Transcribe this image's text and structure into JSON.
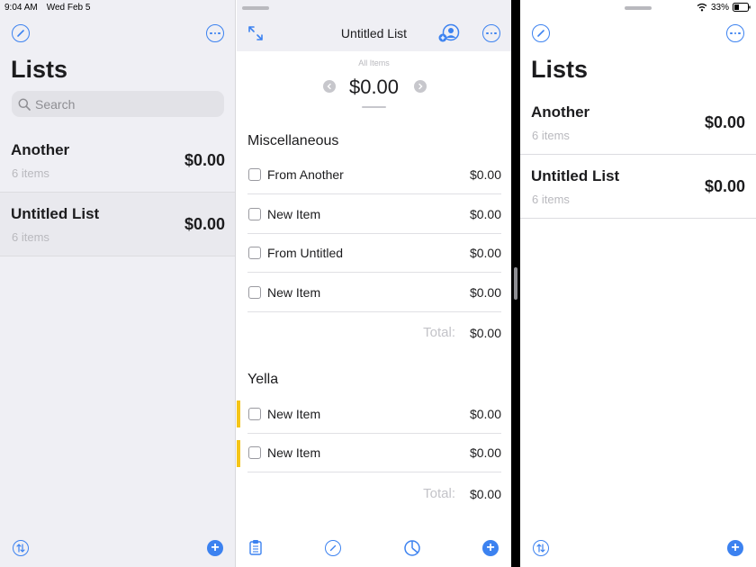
{
  "status": {
    "time": "9:04 AM",
    "date": "Wed Feb 5",
    "battery": "33%"
  },
  "sidebar": {
    "title": "Lists",
    "search_placeholder": "Search",
    "lists": [
      {
        "name": "Another",
        "count": "6 items",
        "amount": "$0.00"
      },
      {
        "name": "Untitled List",
        "count": "6 items",
        "amount": "$0.00"
      }
    ]
  },
  "detail": {
    "title": "Untitled List",
    "filter_label": "All Items",
    "total_amount": "$0.00",
    "sections": [
      {
        "title": "Miscellaneous",
        "items": [
          {
            "label": "From Another",
            "price": "$0.00"
          },
          {
            "label": "New Item",
            "price": "$0.00"
          },
          {
            "label": "From Untitled",
            "price": "$0.00"
          },
          {
            "label": "New Item",
            "price": "$0.00"
          }
        ],
        "total_label": "Total:",
        "total_value": "$0.00"
      },
      {
        "title": "Yella",
        "flag_color": "#f5c518",
        "items": [
          {
            "label": "New Item",
            "price": "$0.00"
          },
          {
            "label": "New Item",
            "price": "$0.00"
          }
        ],
        "total_label": "Total:",
        "total_value": "$0.00"
      }
    ]
  },
  "right_panel": {
    "title": "Lists",
    "lists": [
      {
        "name": "Another",
        "count": "6 items",
        "amount": "$0.00"
      },
      {
        "name": "Untitled List",
        "count": "6 items",
        "amount": "$0.00"
      }
    ]
  },
  "icons": {
    "compose": "compose-icon",
    "more": "more-icon",
    "sort": "sort-icon",
    "add": "add-icon",
    "expand": "expand-icon",
    "share": "share-person-icon",
    "clipboard": "clipboard-icon",
    "pie": "pie-chart-icon",
    "prev": "chevron-left-icon",
    "next": "chevron-right-icon",
    "search": "search-icon",
    "wifi": "wifi-icon",
    "battery": "battery-icon"
  },
  "colors": {
    "accent": "#3c82f0",
    "sidebar_bg": "#efeff4",
    "secondary_text": "#b9b9be",
    "flag_yellow": "#f5c518"
  }
}
